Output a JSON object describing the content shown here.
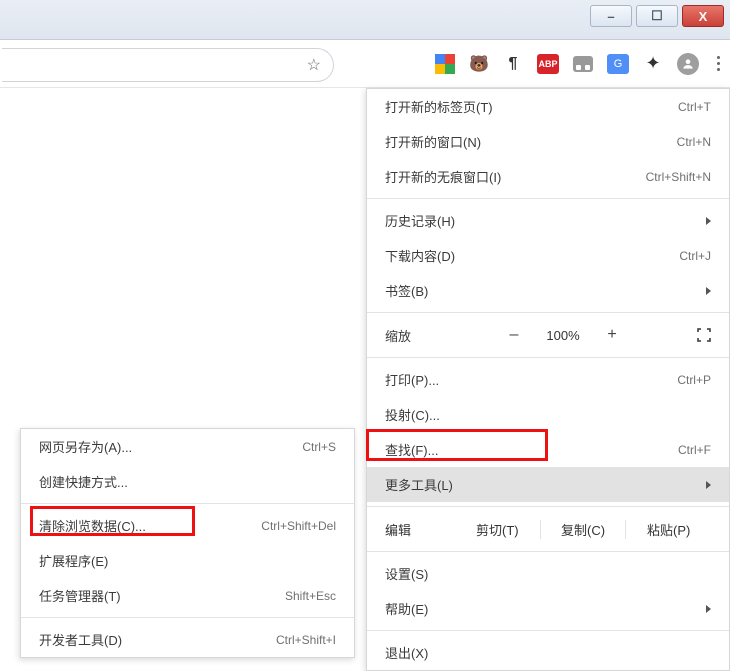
{
  "window_controls": {
    "min": "–",
    "max": "☐",
    "close": "X"
  },
  "omnibox": {
    "star": "☆"
  },
  "ext_icons": {
    "abp": "ABP",
    "para": "¶",
    "grid": "",
    "gtrans": "G",
    "panel": "",
    "puzzle": "✦",
    "avatar": "👤"
  },
  "menu": {
    "newtab": {
      "label": "打开新的标签页(T)",
      "shortcut": "Ctrl+T"
    },
    "newwin": {
      "label": "打开新的窗口(N)",
      "shortcut": "Ctrl+N"
    },
    "incog": {
      "label": "打开新的无痕窗口(I)",
      "shortcut": "Ctrl+Shift+N"
    },
    "history": {
      "label": "历史记录(H)"
    },
    "downloads": {
      "label": "下载内容(D)",
      "shortcut": "Ctrl+J"
    },
    "bookmarks": {
      "label": "书签(B)"
    },
    "zoom": {
      "label": "缩放",
      "minus": "–",
      "value": "100%",
      "plus": "+"
    },
    "print": {
      "label": "打印(P)...",
      "shortcut": "Ctrl+P"
    },
    "cast": {
      "label": "投射(C)..."
    },
    "find": {
      "label": "查找(F)...",
      "shortcut": "Ctrl+F"
    },
    "moretools": {
      "label": "更多工具(L)"
    },
    "edit": {
      "label": "编辑",
      "cut": "剪切(T)",
      "copy": "复制(C)",
      "paste": "粘贴(P)"
    },
    "settings": {
      "label": "设置(S)"
    },
    "help": {
      "label": "帮助(E)"
    },
    "exit": {
      "label": "退出(X)"
    }
  },
  "submenu": {
    "saveas": {
      "label": "网页另存为(A)...",
      "shortcut": "Ctrl+S"
    },
    "shortcut": {
      "label": "创建快捷方式..."
    },
    "cleardata": {
      "label": "清除浏览数据(C)...",
      "shortcut": "Ctrl+Shift+Del"
    },
    "extensions": {
      "label": "扩展程序(E)"
    },
    "taskmgr": {
      "label": "任务管理器(T)",
      "shortcut": "Shift+Esc"
    },
    "devtools": {
      "label": "开发者工具(D)",
      "shortcut": "Ctrl+Shift+I"
    }
  }
}
